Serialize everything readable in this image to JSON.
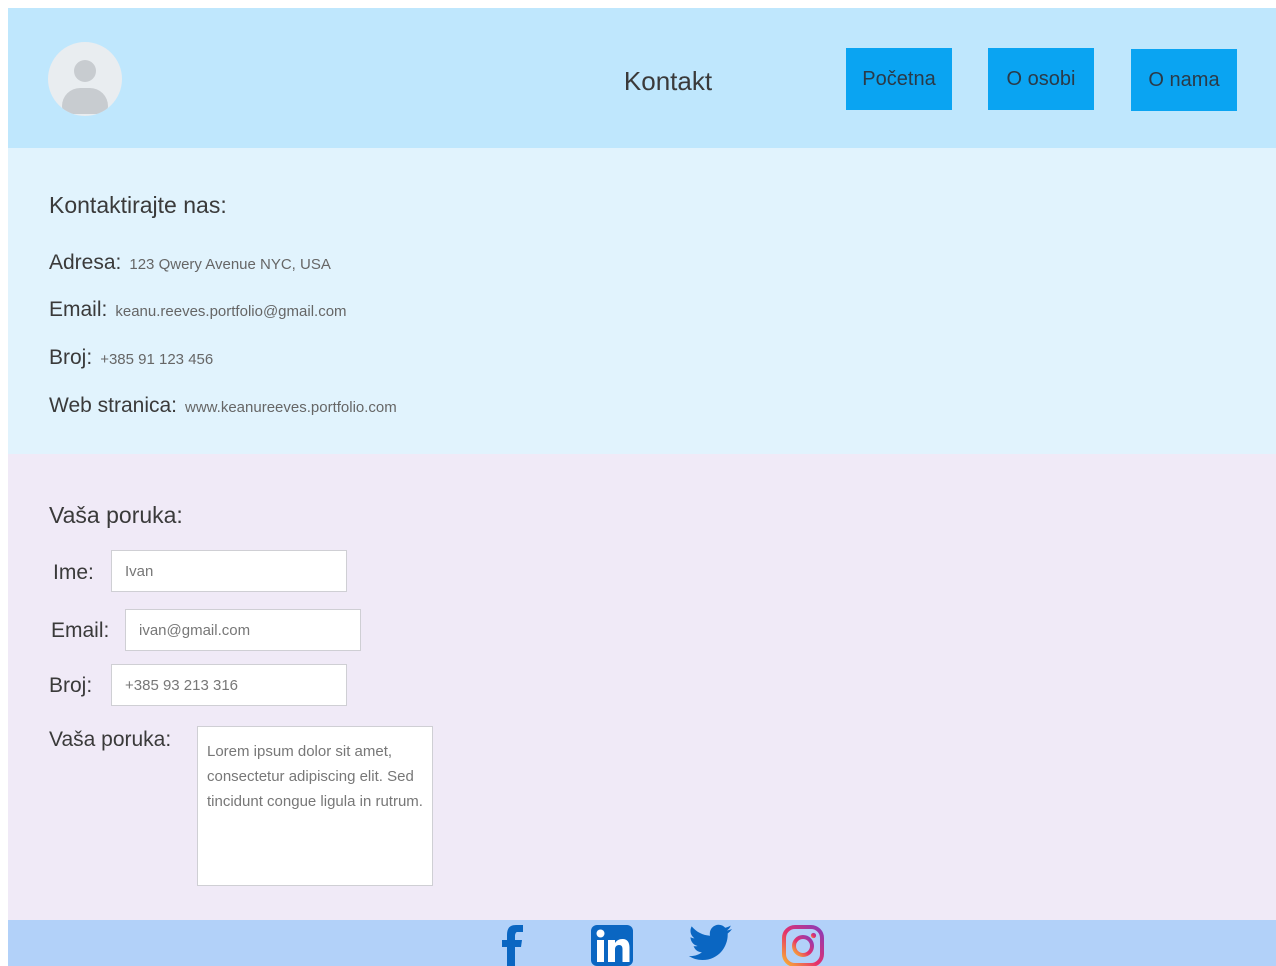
{
  "header": {
    "title": "Kontakt",
    "nav": [
      {
        "label": "Početna"
      },
      {
        "label": "O osobi"
      },
      {
        "label": "O nama"
      }
    ]
  },
  "contact": {
    "title": "Kontaktirajte nas:",
    "rows": [
      {
        "label": "Adresa:",
        "value": "123 Qwery Avenue NYC, USA"
      },
      {
        "label": "Email:",
        "value": "keanu.reeves.portfolio@gmail.com"
      },
      {
        "label": "Broj:",
        "value": "+385 91 123 456"
      },
      {
        "label": "Web stranica:",
        "value": "www.keanureeves.portfolio.com"
      }
    ]
  },
  "form": {
    "title": "Vaša poruka:",
    "name_label": "Ime:",
    "name_value": "Ivan",
    "email_label": "Email:",
    "email_value": "ivan@gmail.com",
    "phone_label": "Broj:",
    "phone_value": "+385 93 213 316",
    "message_label": "Vaša poruka:",
    "message_value": "Lorem ipsum dolor sit amet, consectetur adipiscing elit. Sed tincidunt congue ligula in rutrum."
  },
  "footer": {
    "icons": [
      "facebook-icon",
      "linkedin-icon",
      "twitter-icon",
      "instagram-icon"
    ]
  },
  "colors": {
    "header_bg": "#bfe7fd",
    "nav_button": "#0aa4f2",
    "contact_bg": "#e1f3fd",
    "form_bg": "#f0eaf7",
    "footer_bg": "#b2d1f9",
    "social_icon": "#0a66c2"
  }
}
